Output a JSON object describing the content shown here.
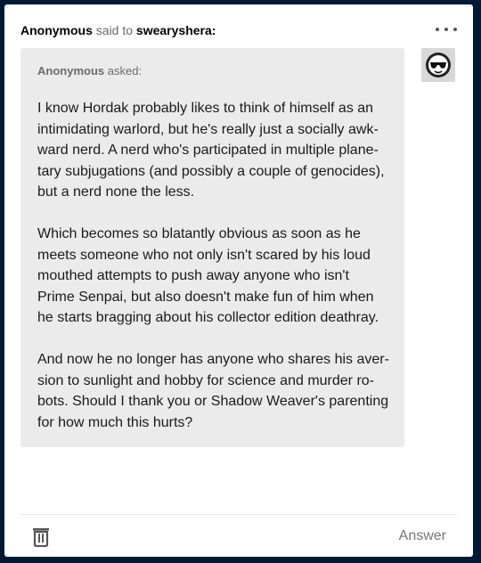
{
  "header": {
    "sender": "Anonymous",
    "said_to": "said to",
    "recipient": "swearyshera:"
  },
  "ask": {
    "asker": "Anonymous",
    "asked_label": "asked:",
    "paragraphs": [
      "I know Hordak probably likes to think of himself as an intimidating warlord, but he's really just a socially awk-ward nerd. A nerd who's participated in multiple plane-tary subjugations (and possibly a couple of genocides), but a nerd none the less.",
      "Which becomes so blatantly obvious as soon as he meets someone who not only isn't scared by his loud mouthed attempts to push away anyone who isn't Prime Senpai, but also doesn't make fun of him when he starts bragging about his collector edition deathray.",
      "And now he no longer has anyone who shares his aver-sion to sunlight and hobby for science and murder ro-bots. Should I thank you or Shadow Weaver's parenting for how much this hurts?"
    ]
  },
  "footer": {
    "answer_label": "Answer"
  },
  "icons": {
    "more": "more-options-icon",
    "avatar": "anonymous-sunglasses-avatar",
    "trash": "trash-icon"
  },
  "colors": {
    "background": "#001935",
    "card": "#ffffff",
    "bubble": "#ebebeb"
  }
}
